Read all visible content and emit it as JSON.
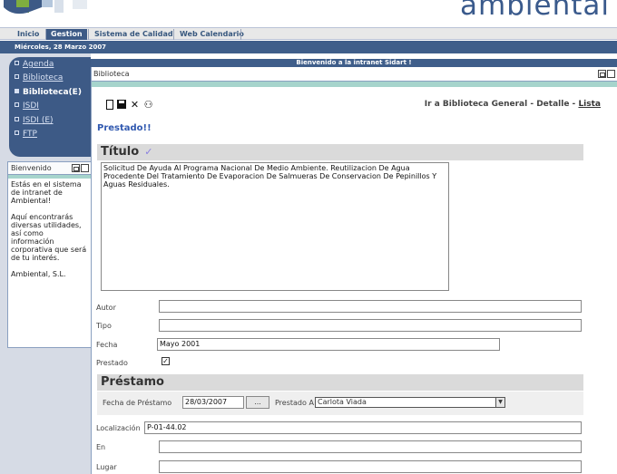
{
  "brand": "ambiental",
  "nav": {
    "tabs": [
      "Inicio",
      "Gestion",
      "Sistema de Calidad",
      "Web Calendario"
    ],
    "active": "Gestion"
  },
  "date": "Miércoles, 28 Marzo 2007",
  "welcome_strip": "Bienvenido a la intranet Sidart !",
  "menu": {
    "items": [
      "Agenda",
      "Biblioteca",
      "Biblioteca(E)",
      "ISDI",
      "ISDI (E)",
      "FTP"
    ],
    "active": "Biblioteca(E)"
  },
  "welcome_panel": {
    "title": "Bienvenido",
    "p1": "Estás en el sistema de intranet de Ambiental!",
    "p2": "Aquí encontrarás diversas utilidades, así como información corporativa que será de tu interés.",
    "p3": "Ambiental, S.L."
  },
  "main": {
    "panel_title": "Biblioteca",
    "breadcrumb": "Ir a Biblioteca General - Detalle - ",
    "breadcrumb_link": "Lista",
    "status_msg": "Prestado!!",
    "titulo_label": "Título",
    "titulo_value": "Solicitud De Ayuda Al Programa Nacional De Medio Ambiente. Reutilizacion De Agua Procedente Del Tratamiento De Evaporacion De Salmueras De Conservacion De Pepinillos Y Aguas Residuales.",
    "fields": {
      "autor_label": "Autor",
      "autor_value": "",
      "tipo_label": "Tipo",
      "tipo_value": "",
      "fecha_label": "Fecha",
      "fecha_value": "Mayo 2001",
      "prestado_label": "Prestado",
      "prestado_checked": true,
      "localizacion_label": "Localización",
      "localizacion_value": "P-01-44.02",
      "en_label": "En",
      "en_value": "",
      "lugar_label": "Lugar",
      "lugar_value": ""
    },
    "prestamo": {
      "label": "Préstamo",
      "fecha_label": "Fecha de Préstamo",
      "fecha_value": "28/03/2007",
      "picker_label": "...",
      "prestado_a_label": "Prestado A",
      "prestado_a_value": "Carlota Viada"
    }
  },
  "colors": {
    "accent": "#3d5a86",
    "teal": "#a6d4cc",
    "brand": "#3a5a8c",
    "status": "#3159b0"
  }
}
